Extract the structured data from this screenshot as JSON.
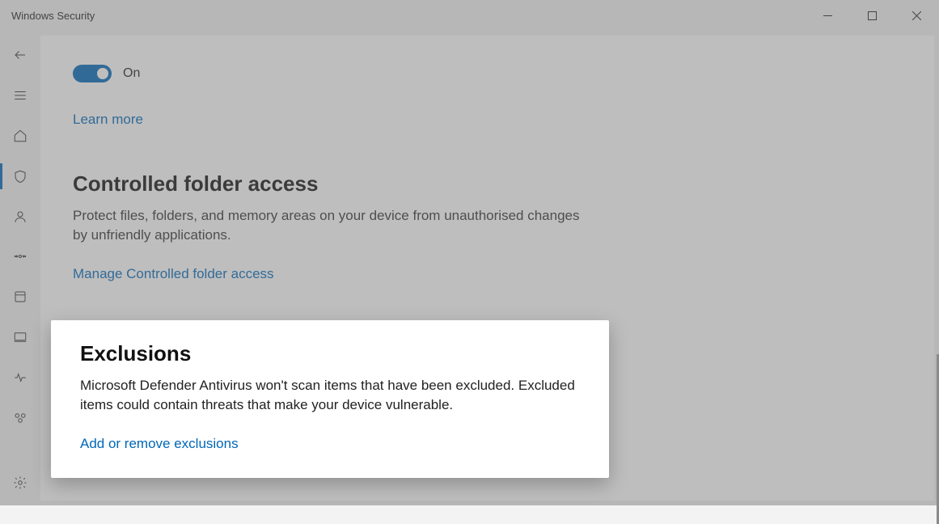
{
  "window": {
    "title": "Windows Security"
  },
  "toggle": {
    "state_label": "On"
  },
  "learn_more": "Learn more",
  "controlled_folder": {
    "heading": "Controlled folder access",
    "body": "Protect files, folders, and memory areas on your device from unauthorised changes by unfriendly applications.",
    "link": "Manage Controlled folder access"
  },
  "exclusions": {
    "heading": "Exclusions",
    "body": "Microsoft Defender Antivirus won't scan items that have been excluded. Excluded items could contain threats that make your device vulnerable.",
    "link": "Add or remove exclusions"
  }
}
